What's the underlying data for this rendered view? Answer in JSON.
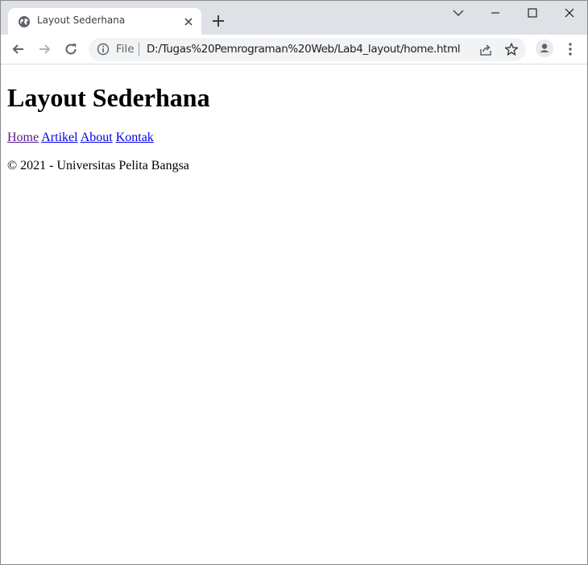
{
  "browser": {
    "tab": {
      "title": "Layout Sederhana",
      "favicon": "globe-icon"
    },
    "omnibox": {
      "scheme": "File",
      "url": "D:/Tugas%20Pemrograman%20Web/Lab4_layout/home.html"
    },
    "icons": [
      "back-arrow-icon",
      "forward-arrow-icon",
      "reload-icon",
      "info-icon",
      "share-icon",
      "star-icon",
      "profile-icon",
      "kebab-menu-icon",
      "tab-search-icon",
      "minimize-icon",
      "maximize-icon",
      "window-close-icon",
      "new-tab-icon",
      "tab-close-icon"
    ],
    "colors": {
      "tabstrip": "#dee1e6",
      "omnibox": "#f1f3f4",
      "link": "#0000ee",
      "visited_link": "#551a8b"
    }
  },
  "page": {
    "title": "Layout Sederhana",
    "nav": {
      "home": "Home",
      "artikel": "Artikel",
      "about": "About",
      "kontak": "Kontak"
    },
    "footer": "© 2021 - Universitas Pelita Bangsa"
  }
}
